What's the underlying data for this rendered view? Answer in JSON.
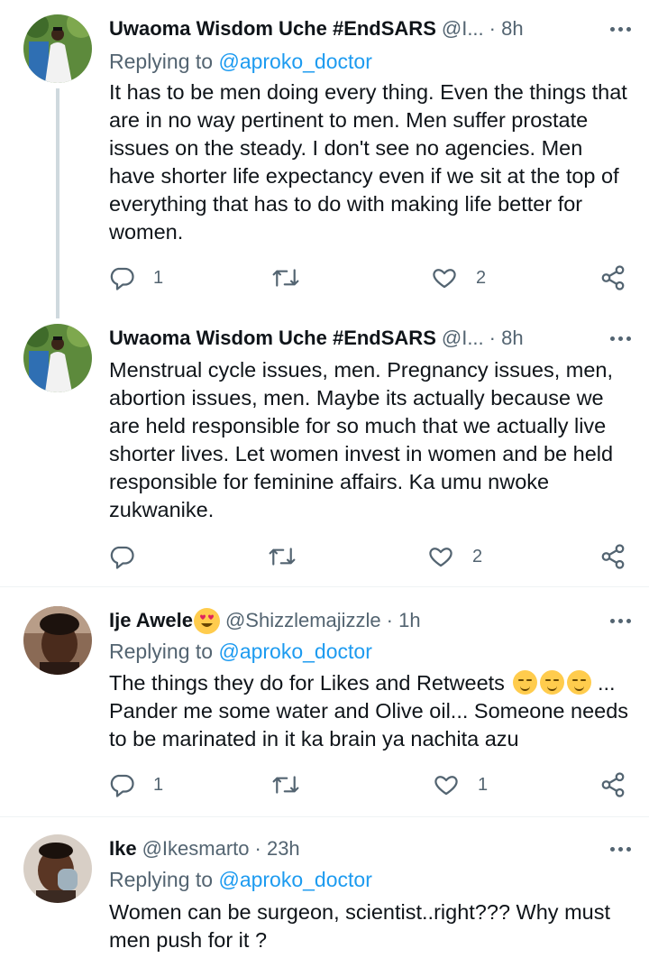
{
  "tweets": [
    {
      "name": "Uwaoma Wisdom Uche #EndSARS",
      "handle": "@I...",
      "time": "· 8h",
      "replying_prefix": "Replying to ",
      "replying_to": "@aproko_doctor",
      "text": "It has to be men doing every thing. Even the things that are in no way pertinent to men. Men suffer prostate issues on the steady. I don't see no agencies. Men have shorter life expectancy even if we sit at the top of everything that has to do with making life better for women.",
      "replies": "1",
      "retweets": "",
      "likes": "2"
    },
    {
      "name": "Uwaoma Wisdom Uche #EndSARS",
      "handle": "@I...",
      "time": "· 8h",
      "text": "Menstrual cycle issues, men. Pregnancy issues, men, abortion issues, men. Maybe its actually because we are held responsible for so much that we actually live shorter lives. Let women invest in women and be held responsible for feminine affairs. Ka umu nwoke zukwanike.",
      "replies": "",
      "retweets": "",
      "likes": "2"
    },
    {
      "name": "Ije Awele",
      "handle": "@Shizzlemajizzle",
      "time": "· 1h",
      "replying_prefix": "Replying to ",
      "replying_to": "@aproko_doctor",
      "text_line1": "The things they do for Likes and Retweets",
      "text_rest": "... Pander me some water and Olive oil... Someone needs to be marinated in it ka brain ya nachita azu",
      "replies": "1",
      "retweets": "",
      "likes": "1"
    },
    {
      "name": "Ike",
      "handle": "@Ikesmarto",
      "time": "· 23h",
      "replying_prefix": "Replying to ",
      "replying_to": "@aproko_doctor",
      "text": "Women can be surgeon, scientist..right??? Why must men push for it ?"
    }
  ],
  "icons": {
    "reply": "reply-icon",
    "retweet": "retweet-icon",
    "like": "heart-icon",
    "share": "share-icon",
    "more": "more-icon"
  },
  "colors": {
    "text": "#0f1419",
    "secondary": "#536471",
    "link": "#1d9bf0",
    "divider": "#eff3f4",
    "thread_line": "#cfd9de"
  }
}
